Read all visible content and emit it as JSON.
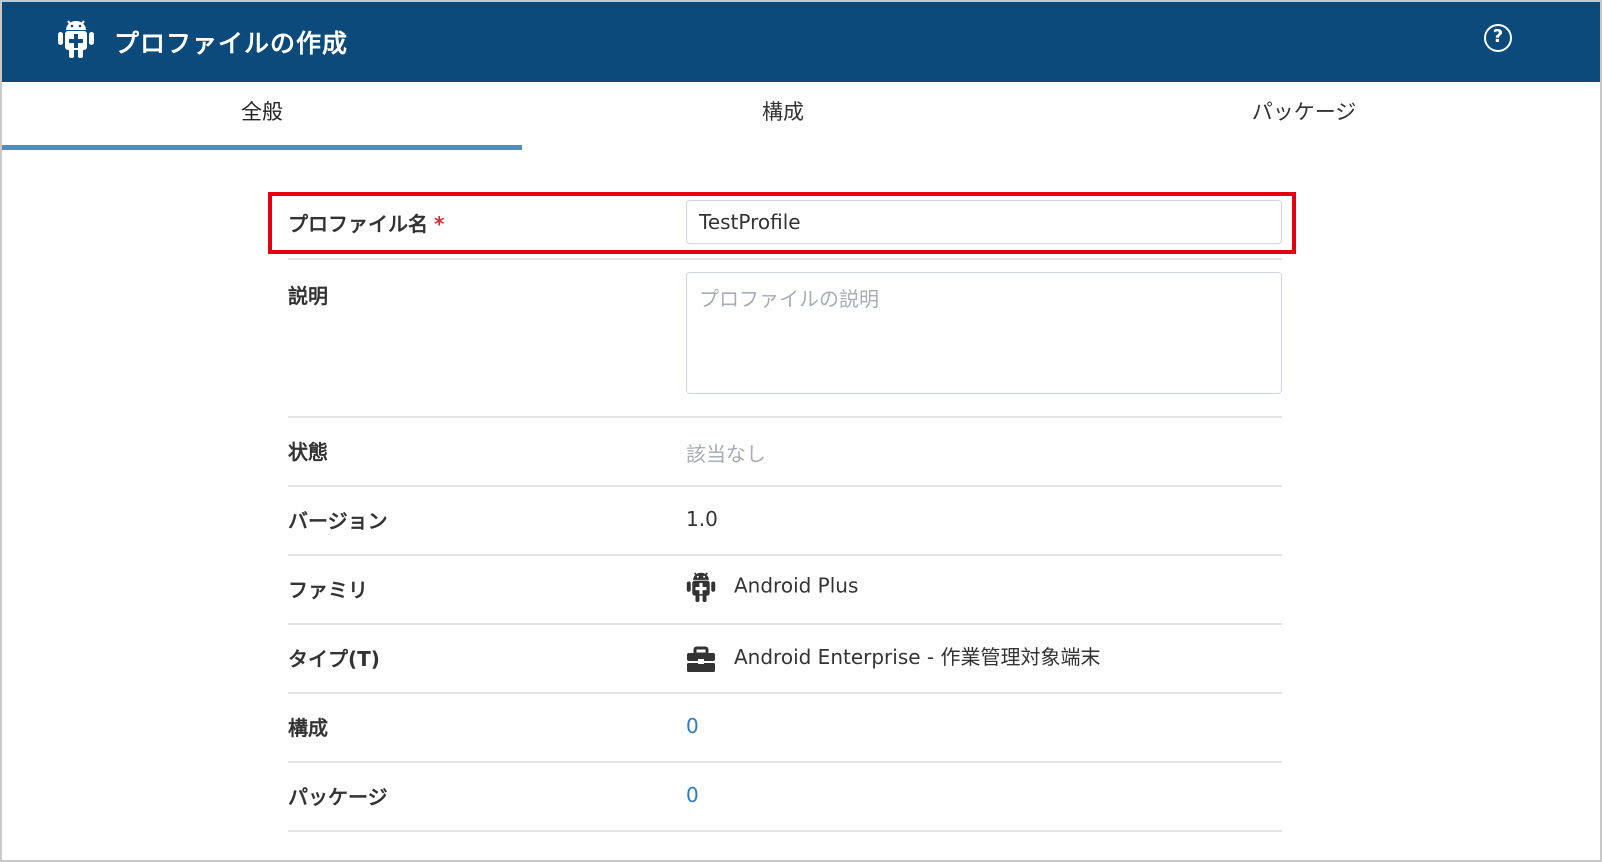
{
  "header": {
    "title": "プロファイルの作成",
    "help_symbol": "?"
  },
  "tabs": [
    {
      "label": "全般",
      "active": true
    },
    {
      "label": "構成",
      "active": false
    },
    {
      "label": "パッケージ",
      "active": false
    }
  ],
  "form": {
    "profile_name": {
      "label": "プロファイル名",
      "required_mark": "*",
      "value": "TestProfile"
    },
    "description": {
      "label": "説明",
      "placeholder": "プロファイルの説明",
      "value": ""
    },
    "status": {
      "label": "状態",
      "value": "該当なし"
    },
    "version": {
      "label": "バージョン",
      "value": "1.0"
    },
    "family": {
      "label": "ファミリ",
      "value": "Android Plus",
      "icon": "android-icon"
    },
    "type": {
      "label": "タイプ(T)",
      "value": "Android Enterprise - 作業管理対象端末",
      "icon": "briefcase-icon"
    },
    "configuration": {
      "label": "構成",
      "value": "0"
    },
    "packages": {
      "label": "パッケージ",
      "value": "0"
    }
  },
  "colors": {
    "header_bg": "#0b4a7a",
    "tab_active": "#4a90c8",
    "link": "#2d7dbd",
    "highlight": "#e3000f",
    "required": "#d62e2e"
  }
}
